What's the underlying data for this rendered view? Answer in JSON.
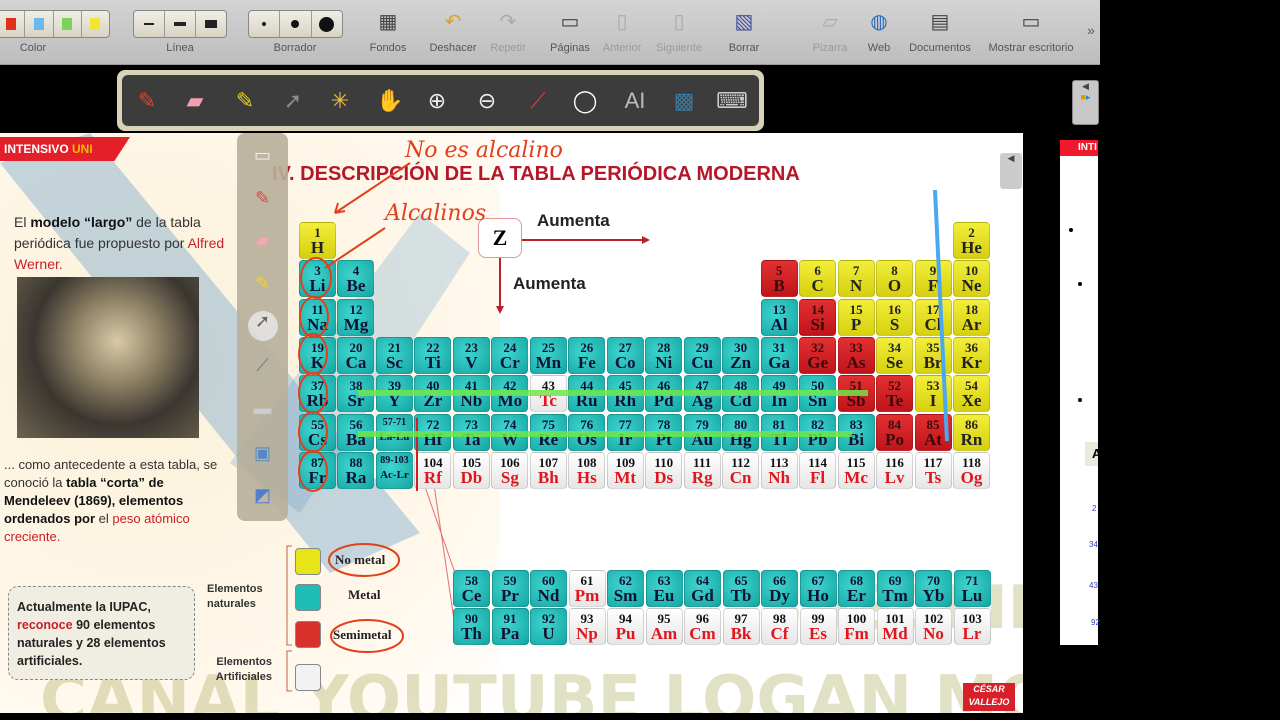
{
  "toolbar": {
    "groups": {
      "color": "Color",
      "linea": "Línea",
      "borrador": "Borrador"
    },
    "colors": [
      "#e0301c",
      "#6ab8f0",
      "#7ad35a",
      "#f3e633"
    ],
    "buttons": [
      {
        "label": "Fondos",
        "icon": "backgrounds-icon",
        "enabled": true
      },
      {
        "label": "Deshacer",
        "icon": "undo-icon",
        "enabled": true
      },
      {
        "label": "Repetir",
        "icon": "redo-icon",
        "enabled": false
      },
      {
        "label": "Páginas",
        "icon": "pages-icon",
        "enabled": true
      },
      {
        "label": "Anterior",
        "icon": "previous-icon",
        "enabled": false
      },
      {
        "label": "Siguiente",
        "icon": "next-icon",
        "enabled": false
      },
      {
        "label": "Borrar",
        "icon": "clear-icon",
        "enabled": true
      },
      {
        "label": "Pizarra",
        "icon": "board-icon",
        "enabled": false
      },
      {
        "label": "Web",
        "icon": "globe-icon",
        "enabled": true
      },
      {
        "label": "Documentos",
        "icon": "folder-icon",
        "enabled": true
      },
      {
        "label": "Mostrar escritorio",
        "icon": "desktop-icon",
        "enabled": true
      }
    ],
    "overflow": "»"
  },
  "floatbar": [
    "pen-icon",
    "eraser-icon",
    "highlighter-icon",
    "pointer-icon",
    "laser-icon",
    "hand-icon",
    "zoom-in-icon",
    "zoom-out-icon",
    "color-picker-icon",
    "line-width-icon",
    "text-recognition-icon",
    "screen-icon",
    "keyboard-icon"
  ],
  "slide": {
    "banner": {
      "a": "INTENSIVO ",
      "b": "UNI"
    },
    "title": "IV. DESCRIPCIÓN DE LA TABLA PERIÓDICA MODERNA",
    "intro": {
      "t1": "El ",
      "b1": "modelo “largo”",
      "t2": " de la tabla periódica fue  propuesto por ",
      "r1": "Alfred Werner."
    },
    "mendeleev": {
      "t1": "... como antecedente a esta tabla, se conoció la ",
      "b1": "tabla “corta” de Mendeleev (1869),  elementos ordenados por ",
      "t2": "el ",
      "r1": "peso atómico creciente."
    },
    "iupac": {
      "b1": "Actualmente la IUPAC, ",
      "r1": "reconoce",
      "b2": " 90 elementos naturales y 28 elementos artificiales."
    },
    "z_label": "Z",
    "aumenta_h": "Aumenta",
    "aumenta_v": "Aumenta",
    "legend": {
      "natural": "Elementos naturales",
      "artificial": "Elementos Artificiales",
      "nonmetal": "No metal",
      "metal": "Metal",
      "semimetal": "Semimetal"
    },
    "annotations": {
      "no_alcalino": "No es alcalino",
      "alcalinos": "Alcalinos"
    },
    "watermark": {
      "line1": "SUSCRIBETE A:",
      "line2": "CANAL YOUTUBE LOGAN MOTUS"
    },
    "logo": {
      "a": "CÉSAR",
      "b": "VALLEJO"
    }
  },
  "category_colors": {
    "n": "#e8e41a",
    "m": "#1fbdb5",
    "s": "#d8202a",
    "a": "#f2f2f2"
  },
  "periodic_table": {
    "rows": [
      [
        [
          1,
          "H",
          "n"
        ],
        null,
        null,
        null,
        null,
        null,
        null,
        null,
        null,
        null,
        null,
        null,
        null,
        null,
        null,
        null,
        null,
        [
          2,
          "He",
          "n"
        ]
      ],
      [
        [
          3,
          "Li",
          "m"
        ],
        [
          4,
          "Be",
          "m"
        ],
        null,
        null,
        null,
        null,
        null,
        null,
        null,
        null,
        null,
        null,
        [
          5,
          "B",
          "s"
        ],
        [
          6,
          "C",
          "n"
        ],
        [
          7,
          "N",
          "n"
        ],
        [
          8,
          "O",
          "n"
        ],
        [
          9,
          "F",
          "n"
        ],
        [
          10,
          "Ne",
          "n"
        ]
      ],
      [
        [
          11,
          "Na",
          "m"
        ],
        [
          12,
          "Mg",
          "m"
        ],
        null,
        null,
        null,
        null,
        null,
        null,
        null,
        null,
        null,
        null,
        [
          13,
          "Al",
          "m"
        ],
        [
          14,
          "Si",
          "s"
        ],
        [
          15,
          "P",
          "n"
        ],
        [
          16,
          "S",
          "n"
        ],
        [
          17,
          "Cl",
          "n"
        ],
        [
          18,
          "Ar",
          "n"
        ]
      ],
      [
        [
          19,
          "K",
          "m"
        ],
        [
          20,
          "Ca",
          "m"
        ],
        [
          21,
          "Sc",
          "m"
        ],
        [
          22,
          "Ti",
          "m"
        ],
        [
          23,
          "V",
          "m"
        ],
        [
          24,
          "Cr",
          "m"
        ],
        [
          25,
          "Mn",
          "m"
        ],
        [
          26,
          "Fe",
          "m"
        ],
        [
          27,
          "Co",
          "m"
        ],
        [
          28,
          "Ni",
          "m"
        ],
        [
          29,
          "Cu",
          "m"
        ],
        [
          30,
          "Zn",
          "m"
        ],
        [
          31,
          "Ga",
          "m"
        ],
        [
          32,
          "Ge",
          "s"
        ],
        [
          33,
          "As",
          "s"
        ],
        [
          34,
          "Se",
          "n"
        ],
        [
          35,
          "Br",
          "n"
        ],
        [
          36,
          "Kr",
          "n"
        ]
      ],
      [
        [
          37,
          "Rb",
          "m"
        ],
        [
          38,
          "Sr",
          "m"
        ],
        [
          39,
          "Y",
          "m"
        ],
        [
          40,
          "Zr",
          "m"
        ],
        [
          41,
          "Nb",
          "m"
        ],
        [
          42,
          "Mo",
          "m"
        ],
        [
          43,
          "Tc",
          "a"
        ],
        [
          44,
          "Ru",
          "m"
        ],
        [
          45,
          "Rh",
          "m"
        ],
        [
          46,
          "Pd",
          "m"
        ],
        [
          47,
          "Ag",
          "m"
        ],
        [
          48,
          "Cd",
          "m"
        ],
        [
          49,
          "In",
          "m"
        ],
        [
          50,
          "Sn",
          "m"
        ],
        [
          51,
          "Sb",
          "s"
        ],
        [
          52,
          "Te",
          "s"
        ],
        [
          53,
          "I",
          "n"
        ],
        [
          54,
          "Xe",
          "n"
        ]
      ],
      [
        [
          55,
          "Cs",
          "m"
        ],
        [
          56,
          "Ba",
          "m"
        ],
        [
          "57-71",
          "La-Lu",
          "m"
        ],
        [
          72,
          "Hf",
          "m"
        ],
        [
          73,
          "Ta",
          "m"
        ],
        [
          74,
          "W",
          "m"
        ],
        [
          75,
          "Re",
          "m"
        ],
        [
          76,
          "Os",
          "m"
        ],
        [
          77,
          "Ir",
          "m"
        ],
        [
          78,
          "Pt",
          "m"
        ],
        [
          79,
          "Au",
          "m"
        ],
        [
          80,
          "Hg",
          "m"
        ],
        [
          81,
          "Tl",
          "m"
        ],
        [
          82,
          "Pb",
          "m"
        ],
        [
          83,
          "Bi",
          "m"
        ],
        [
          84,
          "Po",
          "s"
        ],
        [
          85,
          "At",
          "s"
        ],
        [
          86,
          "Rn",
          "n"
        ]
      ],
      [
        [
          87,
          "Fr",
          "m"
        ],
        [
          88,
          "Ra",
          "m"
        ],
        [
          "89-103",
          "Ac-Lr",
          "m"
        ],
        [
          104,
          "Rf",
          "a"
        ],
        [
          105,
          "Db",
          "a"
        ],
        [
          106,
          "Sg",
          "a"
        ],
        [
          107,
          "Bh",
          "a"
        ],
        [
          108,
          "Hs",
          "a"
        ],
        [
          109,
          "Mt",
          "a"
        ],
        [
          110,
          "Ds",
          "a"
        ],
        [
          111,
          "Rg",
          "a"
        ],
        [
          112,
          "Cn",
          "a"
        ],
        [
          113,
          "Nh",
          "a"
        ],
        [
          114,
          "Fl",
          "a"
        ],
        [
          115,
          "Mc",
          "a"
        ],
        [
          116,
          "Lv",
          "a"
        ],
        [
          117,
          "Ts",
          "a"
        ],
        [
          118,
          "Og",
          "a"
        ]
      ]
    ],
    "lanthanides": [
      [
        58,
        "Ce",
        "m"
      ],
      [
        59,
        "Pr",
        "m"
      ],
      [
        60,
        "Nd",
        "m"
      ],
      [
        61,
        "Pm",
        "a"
      ],
      [
        62,
        "Sm",
        "m"
      ],
      [
        63,
        "Eu",
        "m"
      ],
      [
        64,
        "Gd",
        "m"
      ],
      [
        65,
        "Tb",
        "m"
      ],
      [
        66,
        "Dy",
        "m"
      ],
      [
        67,
        "Ho",
        "m"
      ],
      [
        68,
        "Er",
        "m"
      ],
      [
        69,
        "Tm",
        "m"
      ],
      [
        70,
        "Yb",
        "m"
      ],
      [
        71,
        "Lu",
        "m"
      ]
    ],
    "actinides": [
      [
        90,
        "Th",
        "m"
      ],
      [
        91,
        "Pa",
        "m"
      ],
      [
        92,
        "U",
        "m"
      ],
      [
        93,
        "Np",
        "a"
      ],
      [
        94,
        "Pu",
        "a"
      ],
      [
        95,
        "Am",
        "a"
      ],
      [
        96,
        "Cm",
        "a"
      ],
      [
        97,
        "Bk",
        "a"
      ],
      [
        98,
        "Cf",
        "a"
      ],
      [
        99,
        "Es",
        "a"
      ],
      [
        100,
        "Fm",
        "a"
      ],
      [
        101,
        "Md",
        "a"
      ],
      [
        102,
        "No",
        "a"
      ],
      [
        103,
        "Lr",
        "a"
      ]
    ]
  },
  "right_page": {
    "banner": "INTI",
    "labels": [
      "A",
      "2",
      "34",
      "43",
      "92"
    ]
  }
}
